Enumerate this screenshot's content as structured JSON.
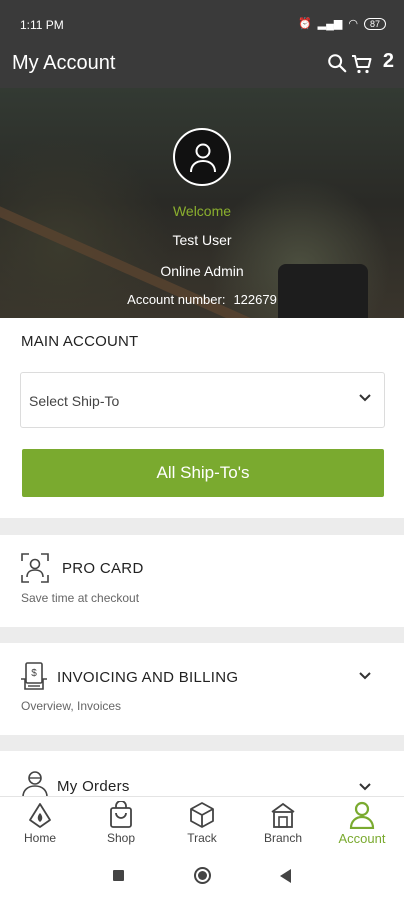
{
  "status_bar": {
    "time": "1:11 PM",
    "battery": "87"
  },
  "app_bar": {
    "title": "My Account",
    "cart_count": "2"
  },
  "profile": {
    "welcome": "Welcome",
    "name": "Test User",
    "role": "Online Admin",
    "account_label": "Account number:",
    "account_number": "122679"
  },
  "main_account": {
    "label": "MAIN ACCOUNT",
    "select_placeholder": "Select Ship-To",
    "button_label": "All Ship-To's"
  },
  "sections": [
    {
      "title": "PRO CARD",
      "subtitle": "Save time at checkout",
      "icon": "pro-card-icon"
    },
    {
      "title": "INVOICING AND BILLING",
      "subtitle": "Overview, Invoices",
      "icon": "invoice-icon"
    },
    {
      "title": "My Orders",
      "icon": "orders-icon"
    }
  ],
  "bottom_nav": [
    {
      "label": "Home",
      "icon": "home-icon"
    },
    {
      "label": "Shop",
      "icon": "shop-icon"
    },
    {
      "label": "Track",
      "icon": "track-icon"
    },
    {
      "label": "Branch",
      "icon": "branch-icon"
    },
    {
      "label": "Account",
      "icon": "account-icon",
      "active": true
    }
  ],
  "colors": {
    "accent": "#7aaa2f",
    "bar": "#3a3a3a"
  }
}
